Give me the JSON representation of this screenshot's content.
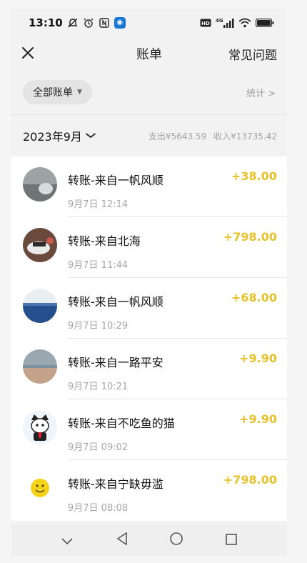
{
  "status": {
    "time": "13:10",
    "network": "4G"
  },
  "nav": {
    "title": "账单",
    "faq": "常见问题"
  },
  "filter": {
    "chip": "全部账单",
    "stats": "统计 >"
  },
  "month": {
    "label": "2023年9月",
    "expense": "支出¥5643.59",
    "income": "收入¥13735.42"
  },
  "records": [
    {
      "name": "转账-来自一帆风顺",
      "time": "9月7日 12:14",
      "amount": "+38.00"
    },
    {
      "name": "转账-来自北海",
      "time": "9月7日 11:44",
      "amount": "+798.00"
    },
    {
      "name": "转账-来自一帆风顺",
      "time": "9月7日 10:29",
      "amount": "+68.00"
    },
    {
      "name": "转账-来自一路平安",
      "time": "9月7日 10:21",
      "amount": "+9.90"
    },
    {
      "name": "转账-来自不吃鱼的猫",
      "time": "9月7日 09:02",
      "amount": "+9.90"
    },
    {
      "name": "转账-来自宁缺毋滥",
      "time": "9月7日 08:08",
      "amount": "+798.00"
    }
  ],
  "colors": {
    "amount": "#e8c22a",
    "accent": "#1976d2"
  }
}
